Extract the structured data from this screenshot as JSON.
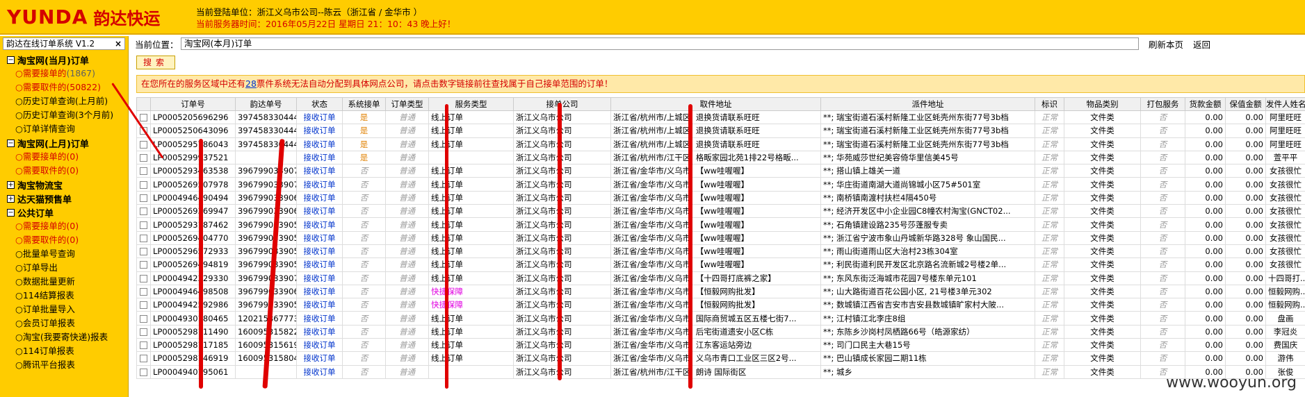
{
  "header": {
    "logo_en": "YUNDA",
    "logo_cn": "韵达快运",
    "line1": "当前登陆单位：浙江义乌市公司--陈云（浙江省 / 金华市 ）",
    "line2": "当前服务器时间：2016年05月22日  星期日  21：10：43 晚上好！"
  },
  "sidebar": {
    "title": "韵达在线订单系统 V1.2",
    "close": "×",
    "groups": [
      {
        "label": "淘宝网(当月)订单",
        "box": "−",
        "items": [
          {
            "text": "需要接单的",
            "count": "(1867)",
            "red": true
          },
          {
            "text": "需要取件的(50822)",
            "count": "",
            "red": true
          },
          {
            "text": "历史订单查询(上月前)",
            "count": "",
            "red": false
          },
          {
            "text": "历史订单查询(3个月前)",
            "count": "",
            "red": false
          },
          {
            "text": "订单详情查询",
            "count": "",
            "red": false
          }
        ]
      },
      {
        "label": "淘宝网(上月)订单",
        "box": "−",
        "items": [
          {
            "text": "需要接单的(0)",
            "count": "",
            "red": true
          },
          {
            "text": "需要取件的(0)",
            "count": "",
            "red": true
          }
        ]
      },
      {
        "label": "淘宝物流宝",
        "box": "+",
        "items": []
      },
      {
        "label": "达天猫预售单",
        "box": "+",
        "items": []
      },
      {
        "label": "公共订单",
        "box": "−",
        "items": [
          {
            "text": "需要接单的(0)",
            "count": "",
            "red": true
          },
          {
            "text": "需要取件的(0)",
            "count": "",
            "red": true
          },
          {
            "text": "批量单号查询",
            "count": "",
            "red": false
          },
          {
            "text": "订单导出",
            "count": "",
            "red": false
          },
          {
            "text": "数据批量更新",
            "count": "",
            "red": false
          },
          {
            "text": "114结算报表",
            "count": "",
            "red": false
          },
          {
            "text": "订单批量导入",
            "count": "",
            "red": false
          },
          {
            "text": "会员订单报表",
            "count": "",
            "red": false
          },
          {
            "text": "淘宝(我要寄快递)报表",
            "count": "",
            "red": false
          },
          {
            "text": "114订单报表",
            "count": "",
            "red": false
          },
          {
            "text": "腾讯平台报表",
            "count": "",
            "red": false
          }
        ]
      }
    ]
  },
  "main": {
    "crumb_label": "当前位置：",
    "crumb_value": "淘宝网(本月)订单",
    "refresh": "刷新本页",
    "back": "返回",
    "search": "搜索",
    "notice_pre": "在您所在的服务区域中还有",
    "notice_num": "28",
    "notice_post": "票件系统无法自动分配到具体网点公司，请点击数字链接前往查找属于自己接单范围的订单！",
    "columns": [
      "",
      "订单号",
      "韵达单号",
      "状态",
      "系统接单",
      "订单类型",
      "服务类型",
      "接单公司",
      "取件地址",
      "派件地址",
      "标识",
      "物品类别",
      "打包服务",
      "货款金额",
      "保值金额",
      "发件人姓名"
    ],
    "rows": [
      [
        "LP0005205696296",
        "3974583304442",
        "接收订单",
        "是",
        "普通",
        "线上订单",
        "浙江义乌市公司",
        "浙江省/杭州市/上城区; 退换货请联系旺旺",
        "**; 瑞宝街道石溪村新隆工业区蚝壳州东街77号3b档",
        "正常",
        "文件类",
        "否",
        "0.00",
        "0.00",
        "阿里旺旺"
      ],
      [
        "LP0005250643096",
        "3974583304442",
        "接收订单",
        "是",
        "普通",
        "线上订单",
        "浙江义乌市公司",
        "浙江省/杭州市/上城区; 退换货请联系旺旺",
        "**; 瑞宝街道石溪村新隆工业区蚝壳州东街77号3b档",
        "正常",
        "文件类",
        "否",
        "0.00",
        "0.00",
        "阿里旺旺"
      ],
      [
        "LP0005295786043",
        "3974583304442",
        "接收订单",
        "是",
        "普通",
        "线上订单",
        "浙江义乌市公司",
        "浙江省/杭州市/上城区; 退换货请联系旺旺",
        "**; 瑞宝街道石溪村新隆工业区蚝壳州东街77号3b档",
        "正常",
        "文件类",
        "否",
        "0.00",
        "0.00",
        "阿里旺旺"
      ],
      [
        "LP0005299937521",
        "",
        "接收订单",
        "是",
        "普通",
        "",
        "浙江义乌市公司",
        "浙江省/杭州市/江干区; 格畈家园北苑1排22号格畈...",
        "**; 华苑威莎世纪美容倚华里信美45号",
        "正常",
        "文件类",
        "否",
        "0.00",
        "0.00",
        "萱平平"
      ],
      [
        "LP0005293463538",
        "3967990339073",
        "接收订单",
        "否",
        "普通",
        "线上订单",
        "浙江义乌市公司",
        "浙江省/金华市/义乌市; 【ww哇喔喔】",
        "**; 搭山镇上雄关一道",
        "正常",
        "文件类",
        "否",
        "0.00",
        "0.00",
        "女孩很忙"
      ],
      [
        "LP0005269507978",
        "3967990339077",
        "接收订单",
        "否",
        "普通",
        "线上订单",
        "浙江义乌市公司",
        "浙江省/金华市/义乌市; 【ww哇喔喔】",
        "**; 华庄街道南湖大道尚锦城小区75#501室",
        "正常",
        "文件类",
        "否",
        "0.00",
        "0.00",
        "女孩很忙"
      ],
      [
        "LP0004946490494",
        "3967990339065",
        "接收订单",
        "否",
        "普通",
        "线上订单",
        "浙江义乌市公司",
        "浙江省/金华市/义乌市; 【ww哇喔喔】",
        "**; 南桥镇南渡村扶栏4隔450号",
        "正常",
        "文件类",
        "否",
        "0.00",
        "0.00",
        "女孩很忙"
      ],
      [
        "LP0005269369947",
        "3967990339062",
        "接收订单",
        "否",
        "普通",
        "线上订单",
        "浙江义乌市公司",
        "浙江省/金华市/义乌市; 【ww哇喔喔】",
        "**; 经济开发区中小企业园C8幢农村淘宝(GNCT02...",
        "正常",
        "文件类",
        "否",
        "0.00",
        "0.00",
        "女孩很忙"
      ],
      [
        "LP0005293187462",
        "3967990339058",
        "接收订单",
        "否",
        "普通",
        "线上订单",
        "浙江义乌市公司",
        "浙江省/金华市/义乌市; 【ww哇喔喔】",
        "**; 石角镇建设路235号莎蓬服专卖",
        "正常",
        "文件类",
        "否",
        "0.00",
        "0.00",
        "女孩很忙"
      ],
      [
        "LP0005269404770",
        "3967990339057",
        "接收订单",
        "否",
        "普通",
        "线上订单",
        "浙江义乌市公司",
        "浙江省/金华市/义乌市; 【ww哇喔喔】",
        "**; 浙江省宁波市象山丹城新华路328号 象山国民...",
        "正常",
        "文件类",
        "否",
        "0.00",
        "0.00",
        "女孩很忙"
      ],
      [
        "LP0005296572933",
        "3967990339055",
        "接收订单",
        "否",
        "普通",
        "线上订单",
        "浙江义乌市公司",
        "浙江省/金华市/义乌市; 【ww哇喔喔】",
        "**; 雨山街道雨山区大治村23栋304室",
        "正常",
        "文件类",
        "否",
        "0.00",
        "0.00",
        "女孩很忙"
      ],
      [
        "LP0005269494819",
        "3967990339053",
        "接收订单",
        "否",
        "普通",
        "线上订单",
        "浙江义乌市公司",
        "浙江省/金华市/义乌市; 【ww哇喔喔】",
        "**; 利民街道利民开发区北京路名流新城2号楼2单...",
        "正常",
        "文件类",
        "否",
        "0.00",
        "0.00",
        "女孩很忙"
      ],
      [
        "LP0004942329330",
        "3967990339076",
        "接收订单",
        "否",
        "普通",
        "线上订单",
        "浙江义乌市公司",
        "浙江省/金华市/义乌市; 【十四哥打底裤之家】",
        "**; 东风东街泛海城市花园7号楼东单元101",
        "正常",
        "文件类",
        "否",
        "0.00",
        "0.00",
        "十四哥打..."
      ],
      [
        "LP0004946498508",
        "3967990339066",
        "接收订单",
        "否",
        "普通",
        "快捷保障",
        "浙江义乌市公司",
        "浙江省/金华市/义乌市; 【恒毅网购批发】",
        "**; 山大路街道百花公园小区, 21号楼3单元302",
        "正常",
        "文件类",
        "否",
        "0.00",
        "0.00",
        "恒毅网购..."
      ],
      [
        "LP0004942592986",
        "3967990339059",
        "接收订单",
        "否",
        "普通",
        "快捷保障",
        "浙江义乌市公司",
        "浙江省/金华市/义乌市; 【恒毅网购批发】",
        "**; 数城镇江西省吉安市吉安县数城镇旷家村大陂...",
        "正常",
        "文件类",
        "否",
        "0.00",
        "0.00",
        "恒毅网购..."
      ],
      [
        "LP0004930180465",
        "1202158677737",
        "接收订单",
        "否",
        "普通",
        "线上订单",
        "浙江义乌市公司",
        "浙江省/金华市/义乌市; 国际商贸城五区五楼七街7...",
        "**; 江村镇江北李庄8组",
        "正常",
        "文件类",
        "否",
        "0.00",
        "0.00",
        "盘画"
      ],
      [
        "LP0005298111490",
        "1600953158228",
        "接收订单",
        "否",
        "普通",
        "线上订单",
        "浙江义乌市公司",
        "浙江省/金华市/义乌市; 后宅街道遗安小区C栋",
        "**; 东陈乡沙岗村凤栖路66号（皓源家纺）",
        "正常",
        "文件类",
        "否",
        "0.00",
        "0.00",
        "李冠炎"
      ],
      [
        "LP0005298117185",
        "1600953156199",
        "接收订单",
        "否",
        "普通",
        "线上订单",
        "浙江义乌市公司",
        "浙江省/金华市/义乌市; 江东客运站旁边",
        "**; 司门口民主大巷15号",
        "正常",
        "文件类",
        "否",
        "0.00",
        "0.00",
        "费国庆"
      ],
      [
        "LP0005298146919",
        "1600953158044",
        "接收订单",
        "否",
        "普通",
        "线上订单",
        "浙江义乌市公司",
        "浙江省/金华市/义乌市; 义乌市青口工业区三区2号...",
        "**; 巴山镇成长家园二期11栋",
        "正常",
        "文件类",
        "否",
        "0.00",
        "0.00",
        "游伟"
      ],
      [
        "LP0004940195061",
        "",
        "接收订单",
        "否",
        "普通",
        "",
        "浙江义乌市公司",
        "浙江省/杭州市/江干区; 朗诗 国际街区",
        "**; 城乡",
        "正常",
        "文件类",
        "否",
        "0.00",
        "0.00",
        "张俊"
      ]
    ]
  },
  "watermark": "www.wooyun.org"
}
